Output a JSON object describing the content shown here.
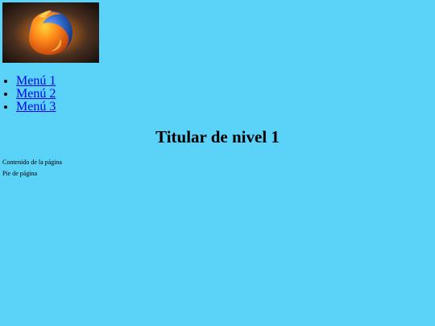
{
  "logo": {
    "icon": "firefox-logo-icon",
    "colors": {
      "globe": "#1f4fa8",
      "flame_light": "#ffd23a",
      "flame_mid": "#ff8a1a",
      "flame_dark": "#c2410c",
      "background_dark": "#1b120c"
    }
  },
  "menu": {
    "items": [
      {
        "label": "Menú 1"
      },
      {
        "label": "Menú 2"
      },
      {
        "label": "Menú 3"
      }
    ]
  },
  "heading": {
    "title": "Titular de nivel 1"
  },
  "content": {
    "text": "Contenido de la página"
  },
  "footer": {
    "text": "Pie de página"
  },
  "colors": {
    "page_background": "#5bd3f8",
    "link": "#0000ee"
  }
}
